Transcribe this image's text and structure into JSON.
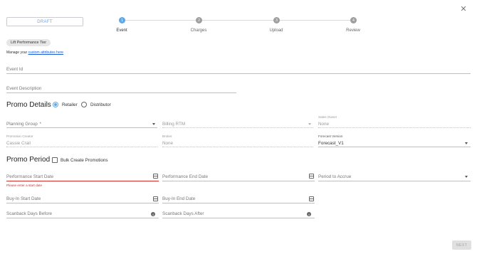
{
  "header": {
    "status": "DRAFT",
    "close_icon": "close-icon"
  },
  "stepper": {
    "steps": [
      {
        "number": "1",
        "label": "Event",
        "state": "active"
      },
      {
        "number": "2",
        "label": "Charges",
        "state": "idle"
      },
      {
        "number": "3",
        "label": "Upload",
        "state": "idle"
      },
      {
        "number": "4",
        "label": "Review",
        "state": "idle"
      }
    ],
    "active_color": "#5fa8e8",
    "idle_color": "#9e9e9e"
  },
  "chip": {
    "label": "Lift Performance Tier"
  },
  "custom_attributes": {
    "prefix": "Manage your ",
    "link": "custom attributes here"
  },
  "event": {
    "id_label": "Event Id",
    "description_label": "Event Description"
  },
  "promo_details": {
    "title": "Promo Details",
    "options": [
      {
        "label": "Retailer",
        "selected": true
      },
      {
        "label": "Distributor",
        "selected": false
      }
    ],
    "planning_group_label": "Planning Group",
    "required_mark": "*",
    "billing_rtm_label": "Billing RTM",
    "sales_owner_label": "Sales Owner",
    "sales_owner_value": "None",
    "promotion_creator_label": "Promotion Creator",
    "promotion_creator_value": "Cassie Crail",
    "broker_label": "Broker",
    "broker_value": "None",
    "forecast_version_label": "Forecast Version",
    "forecast_version_value": "Forecast_V1"
  },
  "promo_period": {
    "title": "Promo Period",
    "bulk_create_label": "Bulk Create Promotions",
    "performance_start_label": "Performance Start Date",
    "performance_start_error": "Please enter a start date",
    "performance_end_label": "Performance End Date",
    "period_to_accrue_label": "Period to Accrue",
    "buyin_start_label": "Buy-In Start Date",
    "buyin_end_label": "Buy-In End Date",
    "scanback_before_label": "Scanback Days Before",
    "scanback_after_label": "Scanback Days After",
    "info_glyph": "i"
  },
  "footer": {
    "next_label": "NEXT"
  },
  "colors": {
    "accent": "#5fa8e8",
    "error": "#d0312d",
    "link": "#1a5bd6"
  }
}
